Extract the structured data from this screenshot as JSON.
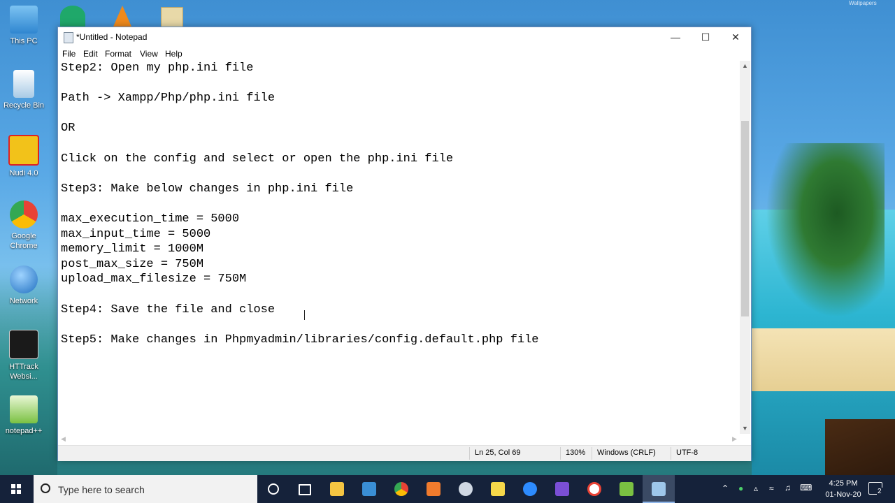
{
  "desktop": {
    "icons": [
      {
        "label": "This PC",
        "icon": "this-pc-icon",
        "color": "#4aa3e6"
      },
      {
        "label": "Recycle Bin",
        "icon": "recycle-bin-icon",
        "color": "#cfe6f7"
      },
      {
        "label": "Nudi 4.0",
        "icon": "nudi-icon",
        "color": "#f2c21a"
      },
      {
        "label": "Google Chrome",
        "icon": "chrome-icon",
        "color": "#e94235"
      },
      {
        "label": "Network",
        "icon": "network-icon",
        "color": "#3a8fd6"
      },
      {
        "label": "HTTrack Websi...",
        "icon": "httrack-icon",
        "color": "#222222"
      },
      {
        "label": "notepad++",
        "icon": "notepadpp-icon",
        "color": "#7ac142"
      }
    ],
    "top_icons": [
      "wifi-app-icon",
      "vlc-icon",
      "installer-icon"
    ],
    "watermark": "Wallpapers"
  },
  "window": {
    "title": "*Untitled - Notepad",
    "menu": [
      "File",
      "Edit",
      "Format",
      "View",
      "Help"
    ],
    "lines": [
      "Step2: Open my php.ini file",
      "",
      "Path -> Xampp/Php/php.ini file",
      "",
      "OR",
      "",
      "Click on the config and select or open the php.ini file",
      "",
      "Step3: Make below changes in php.ini file",
      "",
      "max_execution_time = 5000",
      "max_input_time = 5000",
      "memory_limit = 1000M",
      "post_max_size = 750M",
      "upload_max_filesize = 750M",
      "",
      "Step4: Save the file and close",
      "",
      "Step5: Make changes in Phpmyadmin/libraries/config.default.php file"
    ],
    "status": {
      "position": "Ln 25, Col 69",
      "zoom": "130%",
      "line_ending": "Windows (CRLF)",
      "encoding": "UTF-8"
    }
  },
  "taskbar": {
    "search_placeholder": "Type here to search",
    "apps": [
      {
        "icon": "cortana-icon",
        "color": "#ffffff"
      },
      {
        "icon": "task-view-icon",
        "color": "#ffffff"
      },
      {
        "icon": "file-explorer-icon",
        "color": "#f4c542"
      },
      {
        "icon": "store-icon",
        "color": "#3a8fd6"
      },
      {
        "icon": "chrome-icon",
        "color": "#e94235"
      },
      {
        "icon": "xampp-icon",
        "color": "#f07b2d"
      },
      {
        "icon": "vpn-icon",
        "color": "#cfd8e3"
      },
      {
        "icon": "sticky-notes-icon",
        "color": "#f6d84a"
      },
      {
        "icon": "zoom-icon",
        "color": "#2d8cff"
      },
      {
        "icon": "visual-studio-icon",
        "color": "#7a4fd6"
      },
      {
        "icon": "opera-icon",
        "color": "#e94235"
      },
      {
        "icon": "notepadpp-icon",
        "color": "#7ac142"
      },
      {
        "icon": "notepad-icon",
        "color": "#9ec7ea"
      }
    ],
    "clock_time": "4:25 PM",
    "clock_date": "01-Nov-20",
    "notification_count": "2"
  }
}
